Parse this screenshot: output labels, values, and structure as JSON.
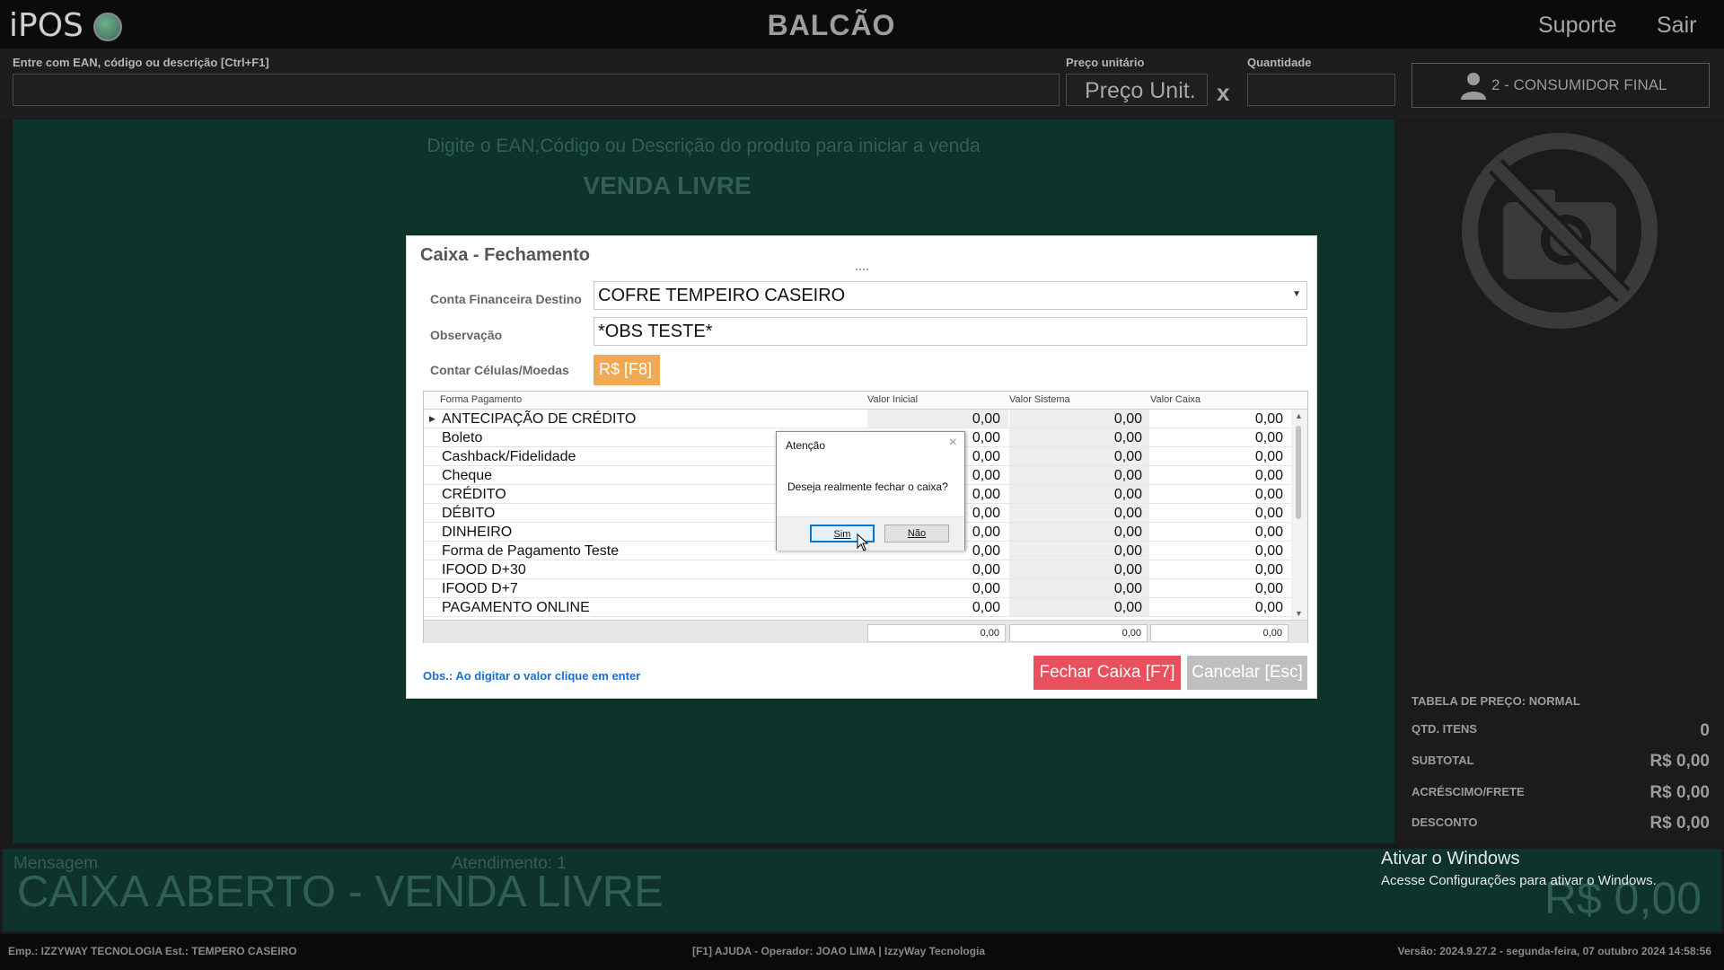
{
  "header": {
    "logo": "iPOS",
    "title": "BALCÃO",
    "suporte": "Suporte",
    "sair": "Sair"
  },
  "inputbar": {
    "search_label": "Entre com EAN, código ou descrição [Ctrl+F1]",
    "price_label": "Preço unitário",
    "price_placeholder": "Preço Unit.",
    "multiply": "x",
    "qty_label": "Quantidade",
    "consumer": "2 - CONSUMIDOR FINAL"
  },
  "main": {
    "hint": "Digite o EAN,Código ou Descrição do produto para iniciar a venda",
    "title": "VENDA LIVRE"
  },
  "summary": {
    "tabela": "TABELA DE PREÇO: NORMAL",
    "qtd_label": "QTD. ITENS",
    "qtd_value": "0",
    "subtotal_label": "SUBTOTAL",
    "subtotal_value": "R$ 0,00",
    "acrescimo_label": "ACRÉSCIMO/FRETE",
    "acrescimo_value": "R$ 0,00",
    "desconto_label": "DESCONTO",
    "desconto_value": "R$ 0,00"
  },
  "status": {
    "mensagem": "Mensagem",
    "atendimento": "Atendimento: 1",
    "big": "CAIXA ABERTO - VENDA LIVRE",
    "total": "R$ 0,00",
    "activate_title": "Ativar o Windows",
    "activate_sub": "Acesse Configurações para ativar o Windows."
  },
  "footer": {
    "left": "Emp.: IZZYWAY TECNOLOGIA  Est.: TEMPERO CASEIRO",
    "center": "[F1] AJUDA - Operador: JOAO LIMA | IzzyWay Tecnologia",
    "right": "Versão: 2024.9.27.2 - segunda-feira, 07 outubro 2024 14:58:56"
  },
  "modal": {
    "title": "Caixa - Fechamento",
    "conta_label": "Conta Financeira Destino",
    "conta_value": "COFRE TEMPEIRO CASEIRO",
    "obs_label": "Observação",
    "obs_value": "*OBS TESTE*",
    "contar_label": "Contar Células/Moedas",
    "rs_button": "R$ [F8]",
    "columns": [
      "Forma Pagamento",
      "Valor Inicial",
      "Valor Sistema",
      "Valor Caixa"
    ],
    "rows": [
      {
        "forma": "ANTECIPAÇÃO DE CRÉDITO",
        "inicial": "0,00",
        "sistema": "0,00",
        "caixa": "0,00"
      },
      {
        "forma": "Boleto",
        "inicial": "0,00",
        "sistema": "0,00",
        "caixa": "0,00"
      },
      {
        "forma": "Cashback/Fidelidade",
        "inicial": "0,00",
        "sistema": "0,00",
        "caixa": "0,00"
      },
      {
        "forma": "Cheque",
        "inicial": "0,00",
        "sistema": "0,00",
        "caixa": "0,00"
      },
      {
        "forma": "CRÉDITO",
        "inicial": "0,00",
        "sistema": "0,00",
        "caixa": "0,00"
      },
      {
        "forma": "DÉBITO",
        "inicial": "0,00",
        "sistema": "0,00",
        "caixa": "0,00"
      },
      {
        "forma": "DINHEIRO",
        "inicial": "0,00",
        "sistema": "0,00",
        "caixa": "0,00"
      },
      {
        "forma": "Forma de Pagamento Teste",
        "inicial": "0,00",
        "sistema": "0,00",
        "caixa": "0,00"
      },
      {
        "forma": "IFOOD D+30",
        "inicial": "0,00",
        "sistema": "0,00",
        "caixa": "0,00"
      },
      {
        "forma": "IFOOD D+7",
        "inicial": "0,00",
        "sistema": "0,00",
        "caixa": "0,00"
      },
      {
        "forma": "PAGAMENTO ONLINE",
        "inicial": "0,00",
        "sistema": "0,00",
        "caixa": "0,00"
      }
    ],
    "totals": {
      "inicial": "0,00",
      "sistema": "0,00",
      "caixa": "0,00"
    },
    "obs_note": "Obs.: Ao digitar o valor clique em enter",
    "fechar": "Fechar Caixa [F7]",
    "cancelar": "Cancelar [Esc]"
  },
  "confirm": {
    "title": "Atenção",
    "close": "×",
    "message": "Deseja realmente fechar o caixa?",
    "sim": "Sim",
    "nao": "Não"
  }
}
